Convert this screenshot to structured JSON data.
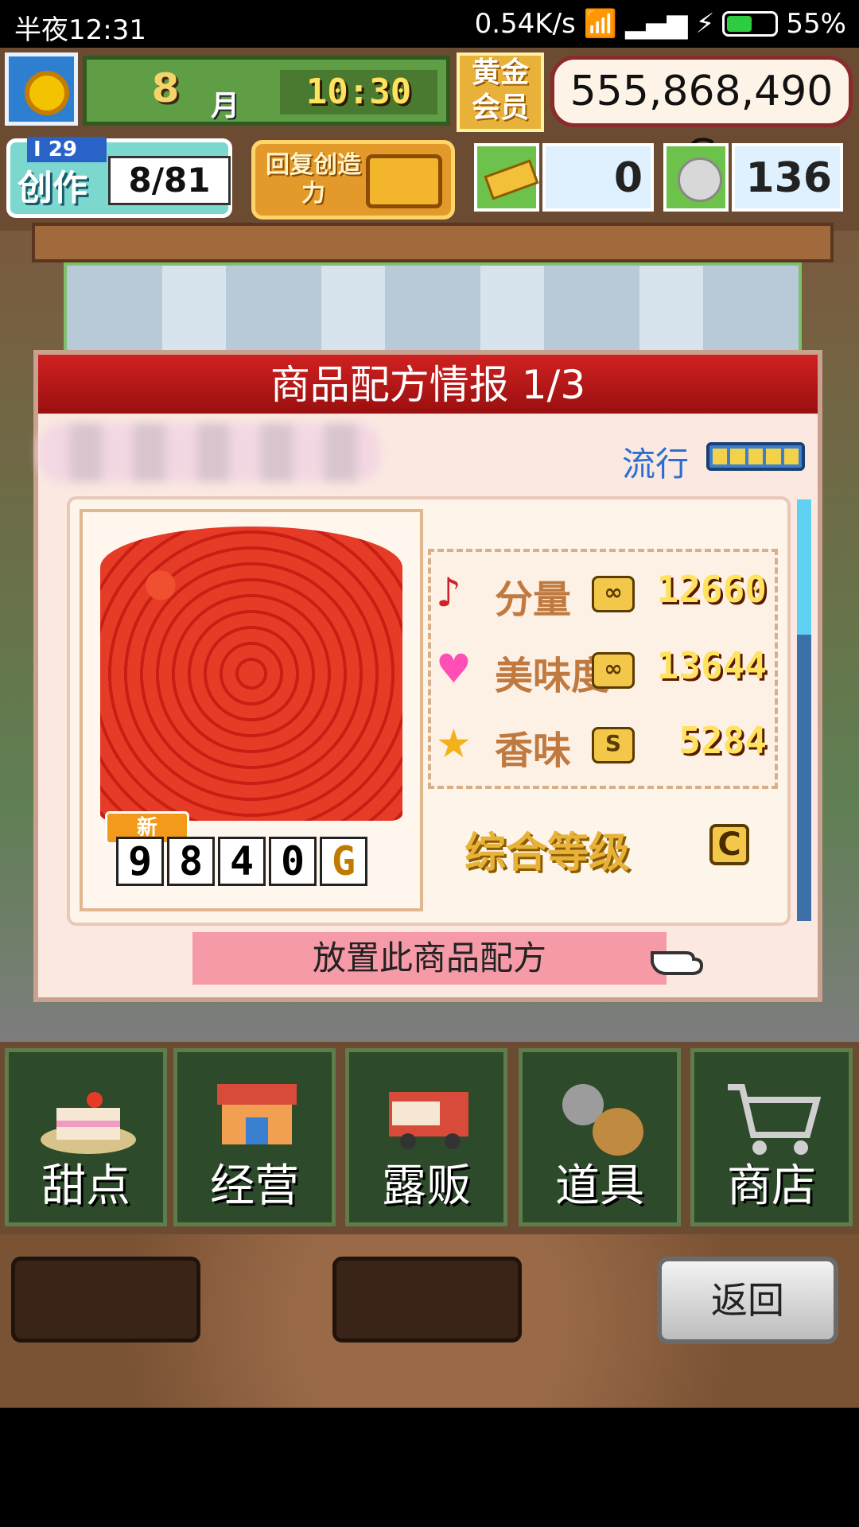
{
  "status_bar": {
    "time": "半夜12:31",
    "network_speed": "0.54K/s",
    "battery": "55%",
    "battery_level": 0.55
  },
  "hud": {
    "month": "8",
    "month_label": "月",
    "clock": "10:30",
    "gold_member": "黄金会员",
    "money": "555,868,490 G",
    "create_label": "创作",
    "create_level": "I 29",
    "create_count": "8/81",
    "restore_label": "回复创造力",
    "ticket_count": "0",
    "coin_count": "136"
  },
  "dialog": {
    "title": "商品配方情报 1/3",
    "trend_label": "流行",
    "trend_level": 5,
    "badge_new": "新",
    "price_digits": [
      "9",
      "8",
      "4",
      "0",
      "G"
    ],
    "stats": [
      {
        "label": "分量",
        "rank": "∞",
        "value": "12660",
        "icon": "music-note-icon"
      },
      {
        "label": "美味度",
        "rank": "∞",
        "value": "13644",
        "icon": "heart-icon"
      },
      {
        "label": "香味",
        "rank": "S",
        "value": "5284",
        "icon": "star-icon"
      }
    ],
    "overall_label": "综合等级",
    "overall_grade": "C",
    "place_button": "放置此商品配方"
  },
  "menu": {
    "items": [
      {
        "label": "甜点",
        "icon": "cake-icon"
      },
      {
        "label": "经营",
        "icon": "shop-icon"
      },
      {
        "label": "露贩",
        "icon": "food-truck-icon"
      },
      {
        "label": "道具",
        "icon": "item-bag-icon"
      },
      {
        "label": "商店",
        "icon": "cart-icon"
      }
    ],
    "back_button": "返回"
  },
  "colors": {
    "header_red": "#c01818",
    "trend_blue": "#2b6fd1",
    "accent_gold": "#e8b23a",
    "button_pink": "#f59aa6"
  }
}
